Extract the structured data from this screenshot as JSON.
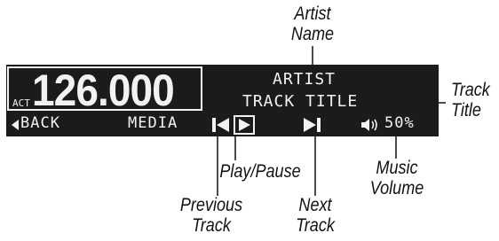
{
  "callouts": {
    "artist_name": [
      "Artist",
      "Name"
    ],
    "track_title": [
      "Track",
      "Title"
    ],
    "play_pause": "Play/Pause",
    "previous_track": [
      "Previous",
      "Track"
    ],
    "next_track": [
      "Next",
      "Track"
    ],
    "music_volume": [
      "Music",
      "Volume"
    ]
  },
  "display": {
    "act_label": "ACT",
    "frequency": "126.000",
    "artist": "ARTIST",
    "track_title": "TRACK TITLE",
    "back_label": "BACK",
    "media_label": "MEDIA",
    "volume": "50%"
  },
  "icons": {
    "back_arrow": "left-triangle-icon",
    "previous": "skip-previous-icon",
    "play": "play-icon",
    "next": "skip-next-icon",
    "volume": "speaker-icon"
  },
  "colors": {
    "panel_background": "#1b1b1b",
    "panel_text": "#f2f2f2",
    "callout_text": "#111111",
    "leader_line": "#111111"
  }
}
